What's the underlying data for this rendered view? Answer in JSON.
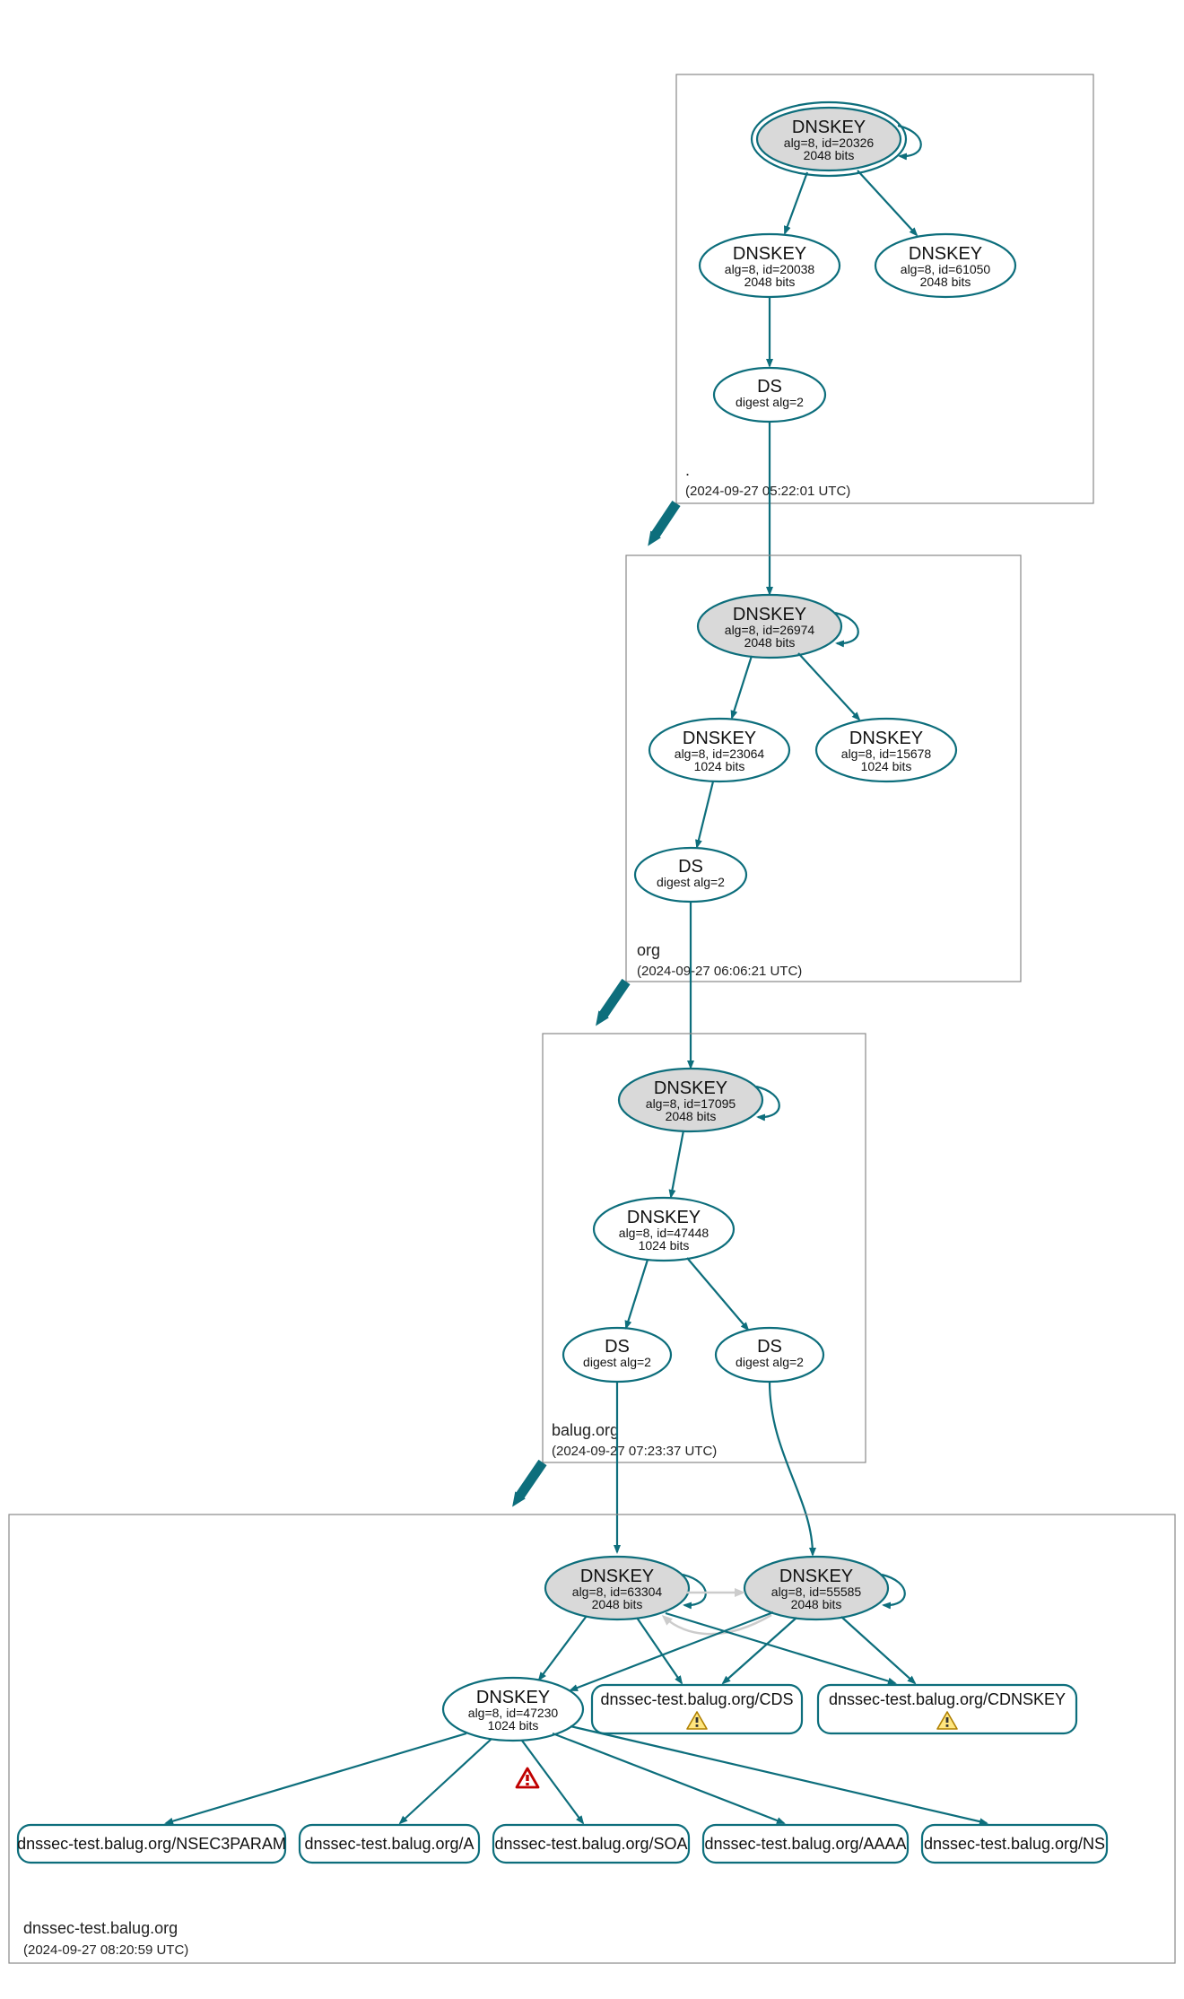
{
  "zones": {
    "root": {
      "label": ".",
      "timestamp": "(2024-09-27 05:22:01 UTC)"
    },
    "org": {
      "label": "org",
      "timestamp": "(2024-09-27 06:06:21 UTC)"
    },
    "balug": {
      "label": "balug.org",
      "timestamp": "(2024-09-27 07:23:37 UTC)"
    },
    "leaf": {
      "label": "dnssec-test.balug.org",
      "timestamp": "(2024-09-27 08:20:59 UTC)"
    }
  },
  "nodes": {
    "root_ksk": {
      "l1": "DNSKEY",
      "l2": "alg=8, id=20326",
      "l3": "2048 bits"
    },
    "root_zsk1": {
      "l1": "DNSKEY",
      "l2": "alg=8, id=20038",
      "l3": "2048 bits"
    },
    "root_zsk2": {
      "l1": "DNSKEY",
      "l2": "alg=8, id=61050",
      "l3": "2048 bits"
    },
    "root_ds": {
      "l1": "DS",
      "l2": "digest alg=2"
    },
    "org_ksk": {
      "l1": "DNSKEY",
      "l2": "alg=8, id=26974",
      "l3": "2048 bits"
    },
    "org_zsk1": {
      "l1": "DNSKEY",
      "l2": "alg=8, id=23064",
      "l3": "1024 bits"
    },
    "org_zsk2": {
      "l1": "DNSKEY",
      "l2": "alg=8, id=15678",
      "l3": "1024 bits"
    },
    "org_ds": {
      "l1": "DS",
      "l2": "digest alg=2"
    },
    "balug_ksk": {
      "l1": "DNSKEY",
      "l2": "alg=8, id=17095",
      "l3": "2048 bits"
    },
    "balug_zsk": {
      "l1": "DNSKEY",
      "l2": "alg=8, id=47448",
      "l3": "1024 bits"
    },
    "balug_ds1": {
      "l1": "DS",
      "l2": "digest alg=2"
    },
    "balug_ds2": {
      "l1": "DS",
      "l2": "digest alg=2"
    },
    "leaf_ksk1": {
      "l1": "DNSKEY",
      "l2": "alg=8, id=63304",
      "l3": "2048 bits"
    },
    "leaf_ksk2": {
      "l1": "DNSKEY",
      "l2": "alg=8, id=55585",
      "l3": "2048 bits"
    },
    "leaf_zsk": {
      "l1": "DNSKEY",
      "l2": "alg=8, id=47230",
      "l3": "1024 bits"
    }
  },
  "rrsets": {
    "cds": "dnssec-test.balug.org/CDS",
    "cdnskey": "dnssec-test.balug.org/CDNSKEY",
    "nsec3": "dnssec-test.balug.org/NSEC3PARAM",
    "a": "dnssec-test.balug.org/A",
    "soa": "dnssec-test.balug.org/SOA",
    "aaaa": "dnssec-test.balug.org/AAAA",
    "ns": "dnssec-test.balug.org/NS"
  }
}
